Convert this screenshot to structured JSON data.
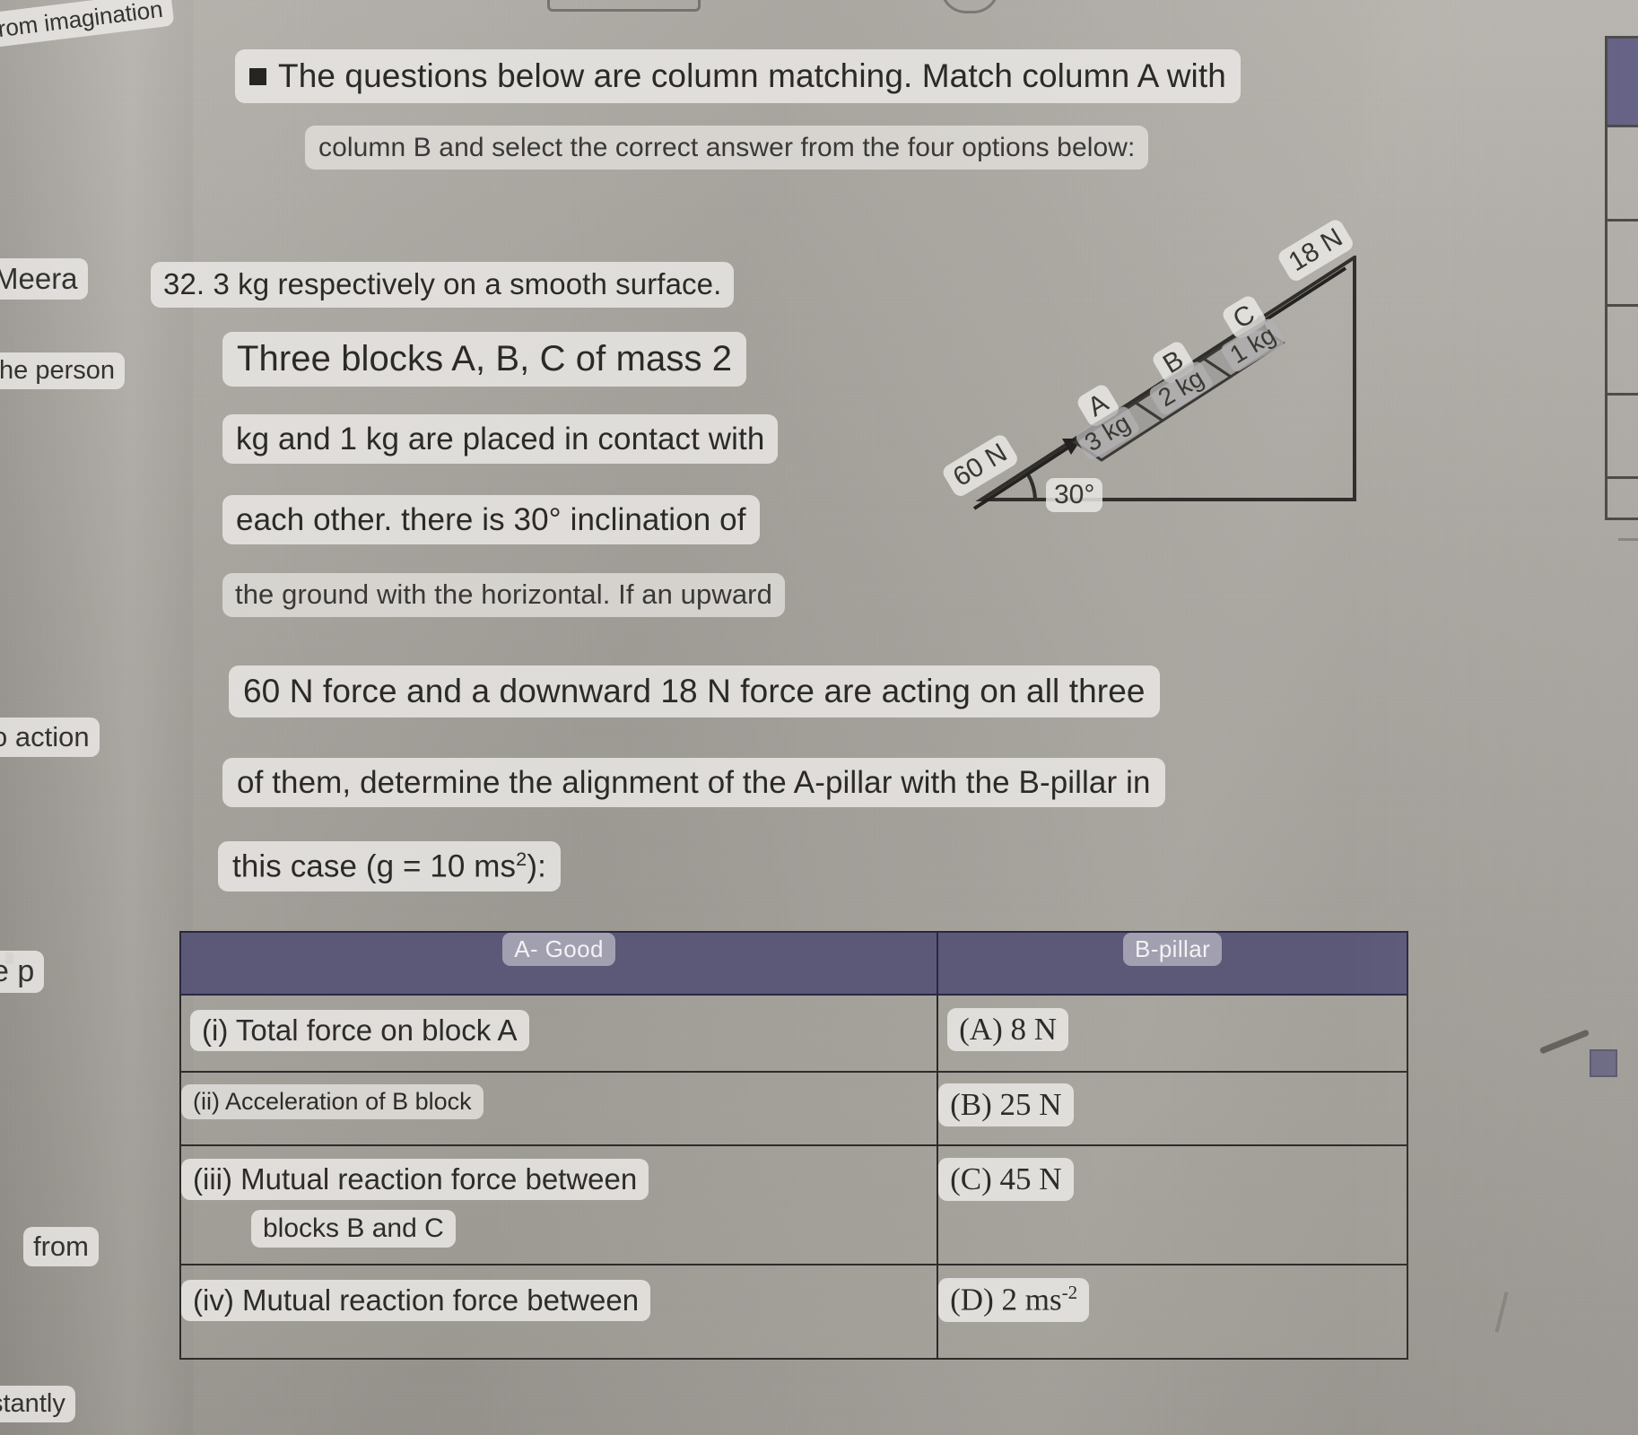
{
  "intro": {
    "bullet_icon": "square-bullet-icon",
    "line1": "The questions below are column matching. Match column A with",
    "line2": "column B and select the correct answer from the four options below:"
  },
  "question": {
    "number_line": "32. 3 kg respectively on a smooth surface.",
    "line2": "Three blocks A, B, C of mass 2",
    "line3": "kg and 1 kg are placed in contact with",
    "line4": "each other. there is 30° inclination of",
    "line5": "the ground with the horizontal. If an upward",
    "line6": "60 N force and a downward 18 N force are acting on all three",
    "line7": "of them, determine the alignment of the A-pillar with the B-pillar in",
    "line8_pre": "this case (g = 10 ms",
    "line8_sup": "2",
    "line8_post": "):"
  },
  "figure": {
    "block_labels": [
      "A",
      "B",
      "C"
    ],
    "block_masses": [
      "3 kg",
      "2 kg",
      "1 kg"
    ],
    "up_force": "60 N",
    "down_force": "18 N",
    "angle": "30°",
    "up_arrow_icon": "arrow-up-incline-icon",
    "down_arrow_icon": "arrow-down-incline-icon"
  },
  "table": {
    "headers": [
      "A- Good",
      "B-pillar"
    ],
    "rows": [
      {
        "a": "(i) Total force on block A",
        "a2": "",
        "b_label": "(A)",
        "b_value": "8 N",
        "b_sup": ""
      },
      {
        "a": "(ii) Acceleration of B block",
        "a2": "",
        "b_label": "(B)",
        "b_value": "25 N",
        "b_sup": ""
      },
      {
        "a": "(iii) Mutual reaction force between",
        "a2": "blocks B and C",
        "b_label": "(C)",
        "b_value": "45 N",
        "b_sup": ""
      },
      {
        "a": "(iv) Mutual reaction force between",
        "a2": "",
        "b_label": "(D)",
        "b_value": "2 ms",
        "b_sup": "-2"
      }
    ]
  },
  "margin_fragments": [
    {
      "text": "rom imagination"
    },
    {
      "text": "Meera"
    },
    {
      "text": "the person"
    },
    {
      "text": "o action"
    },
    {
      "text": "e p"
    },
    {
      "text": "from"
    },
    {
      "text": "stantly"
    }
  ],
  "colors": {
    "header_purple": "#5b5878",
    "chip_background": "#e7e5e2",
    "paper": "#a8a49e",
    "ink": "#2b2a28"
  }
}
